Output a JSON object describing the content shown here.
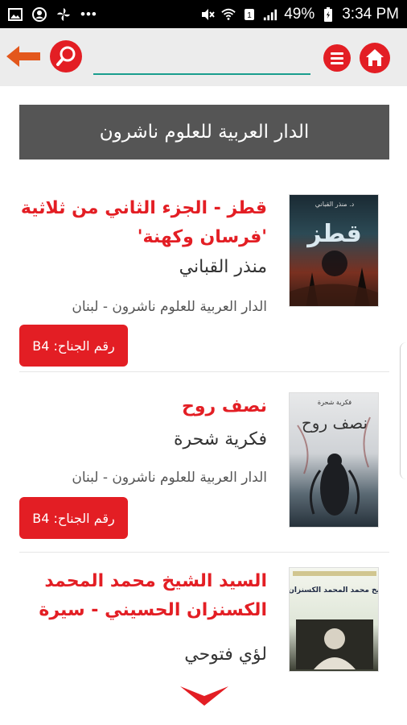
{
  "status_bar": {
    "battery": "49%",
    "time": "3:34 PM",
    "sim": "1"
  },
  "toolbar": {
    "search_value": "",
    "search_placeholder": ""
  },
  "publisher": {
    "name": "الدار العربية للعلوم ناشرون"
  },
  "books": [
    {
      "title": "قطز - الجزء الثاني من ثلاثية 'فرسان وكهنة'",
      "author": "منذر القباني",
      "publisher": "الدار العربية للعلوم ناشرون - لبنان",
      "booth_label": "رقم الجناح:",
      "booth": "B4",
      "cover_author": "د. منذر القباني",
      "cover_title": "قطز"
    },
    {
      "title": "نصف روح",
      "author": "فكرية شحرة",
      "publisher": "الدار العربية للعلوم ناشرون - لبنان",
      "booth_label": "رقم الجناح:",
      "booth": "B4",
      "cover_author": "فكرية شحرة",
      "cover_title": "نصف روح"
    },
    {
      "title": "السيد الشيخ محمد المحمد الكسنزان الحسيني - سيرة",
      "author": "لؤي فتوحي",
      "cover_title": "السيد الشيخ محمد المحمد الكسنزان الحسيني"
    }
  ],
  "colors": {
    "accent": "#e31e24",
    "header_bg": "#555555",
    "toolbar_bg": "#ececec",
    "search_underline": "#1a9e8e"
  }
}
